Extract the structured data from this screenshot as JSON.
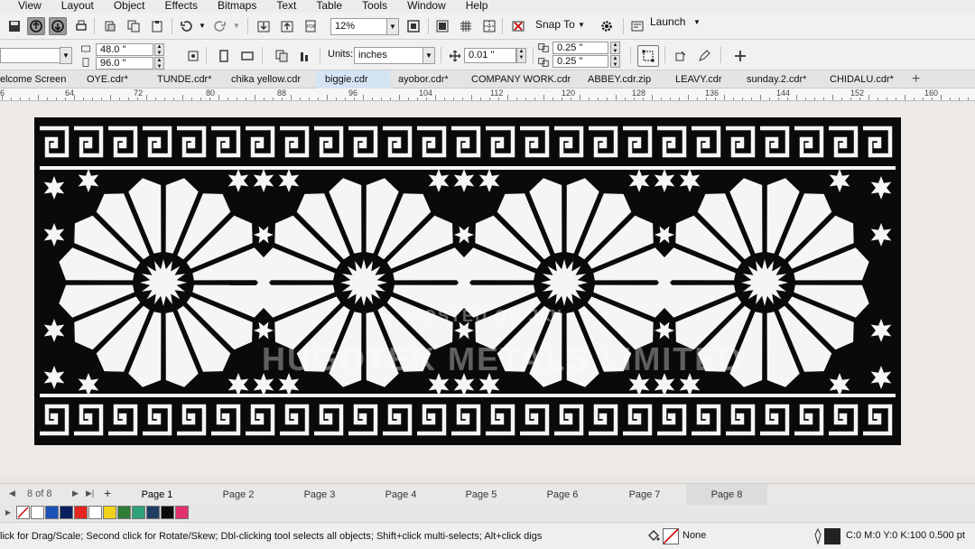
{
  "menu": [
    "View",
    "Layout",
    "Object",
    "Effects",
    "Bitmaps",
    "Text",
    "Table",
    "Tools",
    "Window",
    "Help"
  ],
  "toolbar": {
    "zoom": "12%",
    "snap_label": "Snap To",
    "launch_label": "Launch"
  },
  "property_bar": {
    "width": "48.0 \"",
    "height": "96.0 \"",
    "units_label": "Units:",
    "units_value": "inches",
    "nudge": "0.01 \"",
    "dup_x": "0.25 \"",
    "dup_y": "0.25 \""
  },
  "doc_tabs": [
    "elcome Screen",
    "OYE.cdr*",
    "TUNDE.cdr*",
    "chika yellow.cdr",
    "biggie.cdr",
    "ayobor.cdr*",
    "COMPANY WORK.cdr",
    "ABBEY.cdr.zip",
    "LEAVY.cdr",
    "sunday.2.cdr*",
    "CHIDALU.cdr*"
  ],
  "active_doc_tab": "biggie.cdr",
  "ruler_labels": [
    "6",
    "64",
    "72",
    "80",
    "88",
    "96",
    "104",
    "112",
    "120",
    "128",
    "136",
    "144",
    "152",
    "160"
  ],
  "watermark": {
    "line1": "POSTED ON JIJI",
    "line2": "HUGOTEK METALS LIMITED"
  },
  "page_nav": {
    "counter": "8   of   8",
    "pages": [
      "Page 1",
      "Page 2",
      "Page 3",
      "Page 4",
      "Page 5",
      "Page 6",
      "Page 7",
      "Page 8"
    ],
    "active_page": "Page 8"
  },
  "palette_colors": [
    "#ffffff",
    "#1a52b8",
    "#0b1e5e",
    "#e6251f",
    "#ffffff",
    "#f1d21b",
    "#2f7d34",
    "#2ea17a",
    "#1e3f63",
    "#0c0c0c",
    "#e2326e"
  ],
  "status": {
    "hint": "lick for Drag/Scale; Second click for Rotate/Skew; Dbl-clicking tool selects all objects; Shift+click multi-selects; Alt+click digs",
    "fill_label": "None",
    "outline_info": "C:0 M:0 Y:0 K:100  0.500 pt"
  }
}
